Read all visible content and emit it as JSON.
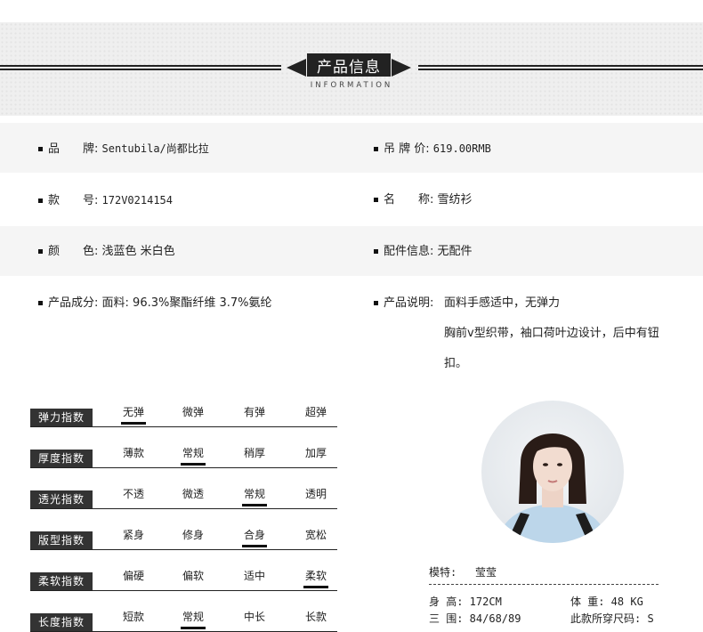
{
  "header": {
    "title": "产品信息",
    "subtitle": "INFORMATION"
  },
  "info": {
    "brand_label": "品　　牌:",
    "brand_value": "Sentubila/尚都比拉",
    "price_label": "吊 牌 价:",
    "price_value": "619.00RMB",
    "style_label": "款　　号:",
    "style_value": "172V0214154",
    "name_label": "名　　称:",
    "name_value": "雪纺衫",
    "color_label": "颜　　色:",
    "color_value": "浅蓝色 米白色",
    "accessory_label": "配件信息:",
    "accessory_value": "无配件",
    "material_label": "产品成分:",
    "material_value": "面料: 96.3%聚酯纤维 3.7%氨纶",
    "desc_label": "产品说明:",
    "desc_lines": [
      "面料手感适中，无弹力",
      "胸前v型织带，袖口荷叶边设计，后中有钮",
      "扣。"
    ]
  },
  "indices": [
    {
      "title": "弹力指数",
      "options": [
        "无弹",
        "微弹",
        "有弹",
        "超弹"
      ],
      "selected": 0
    },
    {
      "title": "厚度指数",
      "options": [
        "薄款",
        "常规",
        "稍厚",
        "加厚"
      ],
      "selected": 1
    },
    {
      "title": "透光指数",
      "options": [
        "不透",
        "微透",
        "常规",
        "透明"
      ],
      "selected": 2
    },
    {
      "title": "版型指数",
      "options": [
        "紧身",
        "修身",
        "合身",
        "宽松"
      ],
      "selected": 2
    },
    {
      "title": "柔软指数",
      "options": [
        "偏硬",
        "偏软",
        "适中",
        "柔软"
      ],
      "selected": 3
    },
    {
      "title": "长度指数",
      "options": [
        "短款",
        "常规",
        "中长",
        "长款"
      ],
      "selected": 1
    }
  ],
  "model": {
    "label": "模特:",
    "name": "莹莹",
    "height": "身 高: 172CM",
    "weight": "体 重: 48 KG",
    "measurements": "三 围: 84/68/89",
    "size": "此款所穿尺码: S"
  }
}
